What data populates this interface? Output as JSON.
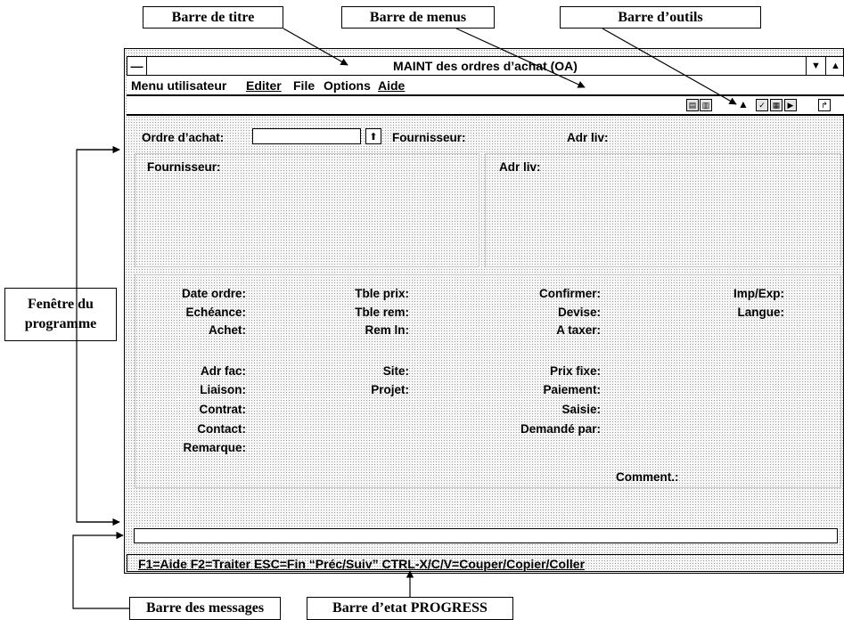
{
  "callouts": {
    "title_bar": "Barre de titre",
    "menu_bar": "Barre de menus",
    "toolbar": "Barre d’outils",
    "program_window": "Fenêtre du programme",
    "program_window_line1": "Fenêtre du",
    "program_window_line2": "programme",
    "message_bar": "Barre des messages",
    "status_bar": "Barre d’etat PROGRESS"
  },
  "window": {
    "title": "MAINT des ordres d’achat (OA)",
    "system_menu_glyph": "—",
    "minimize_glyph": "▼",
    "maximize_glyph": "▲"
  },
  "menu": {
    "items": [
      "Menu utilisateur",
      "Editer",
      "File",
      "Options",
      "Aide"
    ]
  },
  "toolbar": {
    "icons": [
      "copy-icon",
      "paste-icon",
      "pointer-icon",
      "check-icon",
      "form-icon",
      "next-icon",
      "exit-icon"
    ]
  },
  "header": {
    "purchase_order_label": "Ordre d’achat:",
    "purchase_order_value": "",
    "lookup_glyph": "⬆",
    "supplier_label": "Fournisseur:",
    "ship_to_label": "Adr liv:"
  },
  "panels": {
    "supplier_label": "Fournisseur:",
    "ship_to_label": "Adr liv:"
  },
  "fields": {
    "col1": [
      "Date ordre:",
      "Echéance:",
      "Achet:",
      "Adr fac:",
      "Liaison:",
      "Contrat:",
      "Contact:",
      "Remarque:"
    ],
    "col2": [
      "Tble prix:",
      "Tble rem:",
      "Rem ln:",
      "Site:",
      "Projet:"
    ],
    "col3": [
      "Confirmer:",
      "Devise:",
      "A taxer:",
      "Prix fixe:",
      "Paiement:",
      "Saisie:",
      "Demandé par:"
    ],
    "col4": [
      "Imp/Exp:",
      "Langue:"
    ],
    "comment": "Comment.:"
  },
  "status": {
    "text": "F1=Aide  F2=Traiter  ESC=Fin   “Préc/Suiv”  CTRL-X/C/V=Couper/Copier/Coller"
  }
}
